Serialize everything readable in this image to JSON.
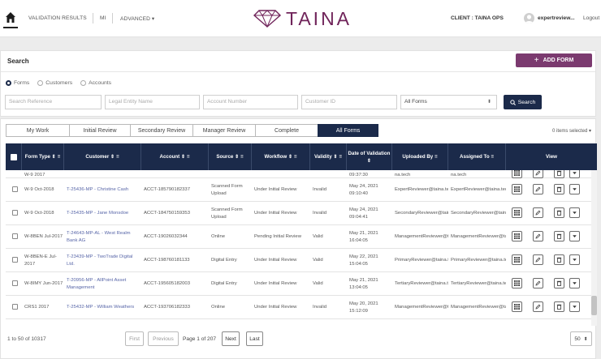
{
  "nav": {
    "links": [
      "VALIDATION RESULTS",
      "MI",
      "ADVANCED"
    ],
    "advanced_caret": "▾",
    "logo": "TAINA",
    "client": "CLIENT : TAINA OPS",
    "user": "expertreview...",
    "logout": "Logout"
  },
  "search": {
    "title": "Search",
    "add_form": "ADD FORM",
    "add_form_plus": "+",
    "radios": [
      "Forms",
      "Customers",
      "Accounts"
    ],
    "fields": {
      "search_reference": "Search Reference",
      "legal_entity": "Legal Entity Name",
      "account_number": "Account Number",
      "customer_id": "Customer ID",
      "form_select": "All Forms"
    },
    "search_button": "Search"
  },
  "tabs": [
    "My Work",
    "Initial Review",
    "Secondary Review",
    "Manager Review",
    "Complete",
    "All Forms"
  ],
  "active_tab": "All Forms",
  "items_selected": "0 items selected ▾",
  "table": {
    "headers": [
      "Form Type",
      "Customer",
      "Account",
      "Source",
      "Workflow",
      "Validity",
      "Date of Validation",
      "Uploaded By",
      "Assigned To",
      "View"
    ],
    "sort_icon": "⇕",
    "menu_icon": "≡",
    "partial_row": {
      "form_type": "W-9 2017",
      "date": "09:37:30",
      "uploaded": "na.tech",
      "assigned": "na.tech"
    },
    "rows": [
      {
        "form_type": "W-9 Oct-2018",
        "customer": "T-25436-MP - Christine Cash",
        "account": "ACCT-185790182337",
        "source": "Scanned Form Upload",
        "workflow": "Under Initial Review",
        "validity": "Invalid",
        "date": "May 24, 2021 09:10:40",
        "uploaded": "ExpertReviewer@taina.tech",
        "assigned": "ExpertReviewer@taina.tech"
      },
      {
        "form_type": "W-9 Oct-2018",
        "customer": "T-25435-MP - Jane Monsdoe",
        "account": "ACCT-184750159353",
        "source": "Scanned Form Upload",
        "workflow": "Under Initial Review",
        "validity": "Invalid",
        "date": "May 24, 2021 09:04:41",
        "uploaded": "SecondaryReviewer@taina.tech",
        "assigned": "SecondaryReviewer@taina.tech"
      },
      {
        "form_type": "W-8BEN Jul-2017",
        "customer": "T-24643-MP-AL - West Realm Bank AG",
        "account": "ACCT-19026032344",
        "source": "Online",
        "workflow": "Pending Initial Review",
        "validity": "Valid",
        "date": "May 21, 2021 16:04:05",
        "uploaded": "ManagementReviewer@taina.tech",
        "assigned": "ManagementReviewer@taina.tech"
      },
      {
        "form_type": "W-8BEN-E Jul-2017",
        "customer": "T-23439-MP - TwoTrade Digital Ltd.",
        "account": "ACCT-198760181133",
        "source": "Digital Entry",
        "workflow": "Under Initial Review",
        "validity": "Valid",
        "date": "May 22, 2021 15:04:05",
        "uploaded": "PrimaryReviewer@taina.tech",
        "assigned": "PrimaryReviewer@taina.tech"
      },
      {
        "form_type": "W-8IMY Jun-2017",
        "customer": "T-20956-MP - AllPoint Asset Management",
        "account": "ACCT-195605182003",
        "source": "Digital Entry",
        "workflow": "Under Initial Review",
        "validity": "Valid",
        "date": "May 21, 2021 13:04:05",
        "uploaded": "TertiaryReviewer@taina.tech",
        "assigned": "TertiaryReviewer@taina.tech"
      },
      {
        "form_type": "CRS1 2017",
        "customer": "T-25432-MP - William Weathers",
        "account": "ACCT-193706182333",
        "source": "Online",
        "workflow": "Under Initial Review",
        "validity": "Invalid",
        "date": "May 20, 2021 15:12:09",
        "uploaded": "ManagementReviewer@taina.tech",
        "assigned": "ManagementReviewer@taina.tech"
      }
    ]
  },
  "pager": {
    "info": "1 to 50 of 10317",
    "first": "First",
    "previous": "Previous",
    "page_label": "Page 1 of 207",
    "next": "Next",
    "last": "Last",
    "per_page": "50"
  },
  "colors": {
    "navy": "#1b2a4a",
    "brand_purple": "#70245a",
    "add_button": "#7b3a6f",
    "link_blue": "#5866a8"
  }
}
